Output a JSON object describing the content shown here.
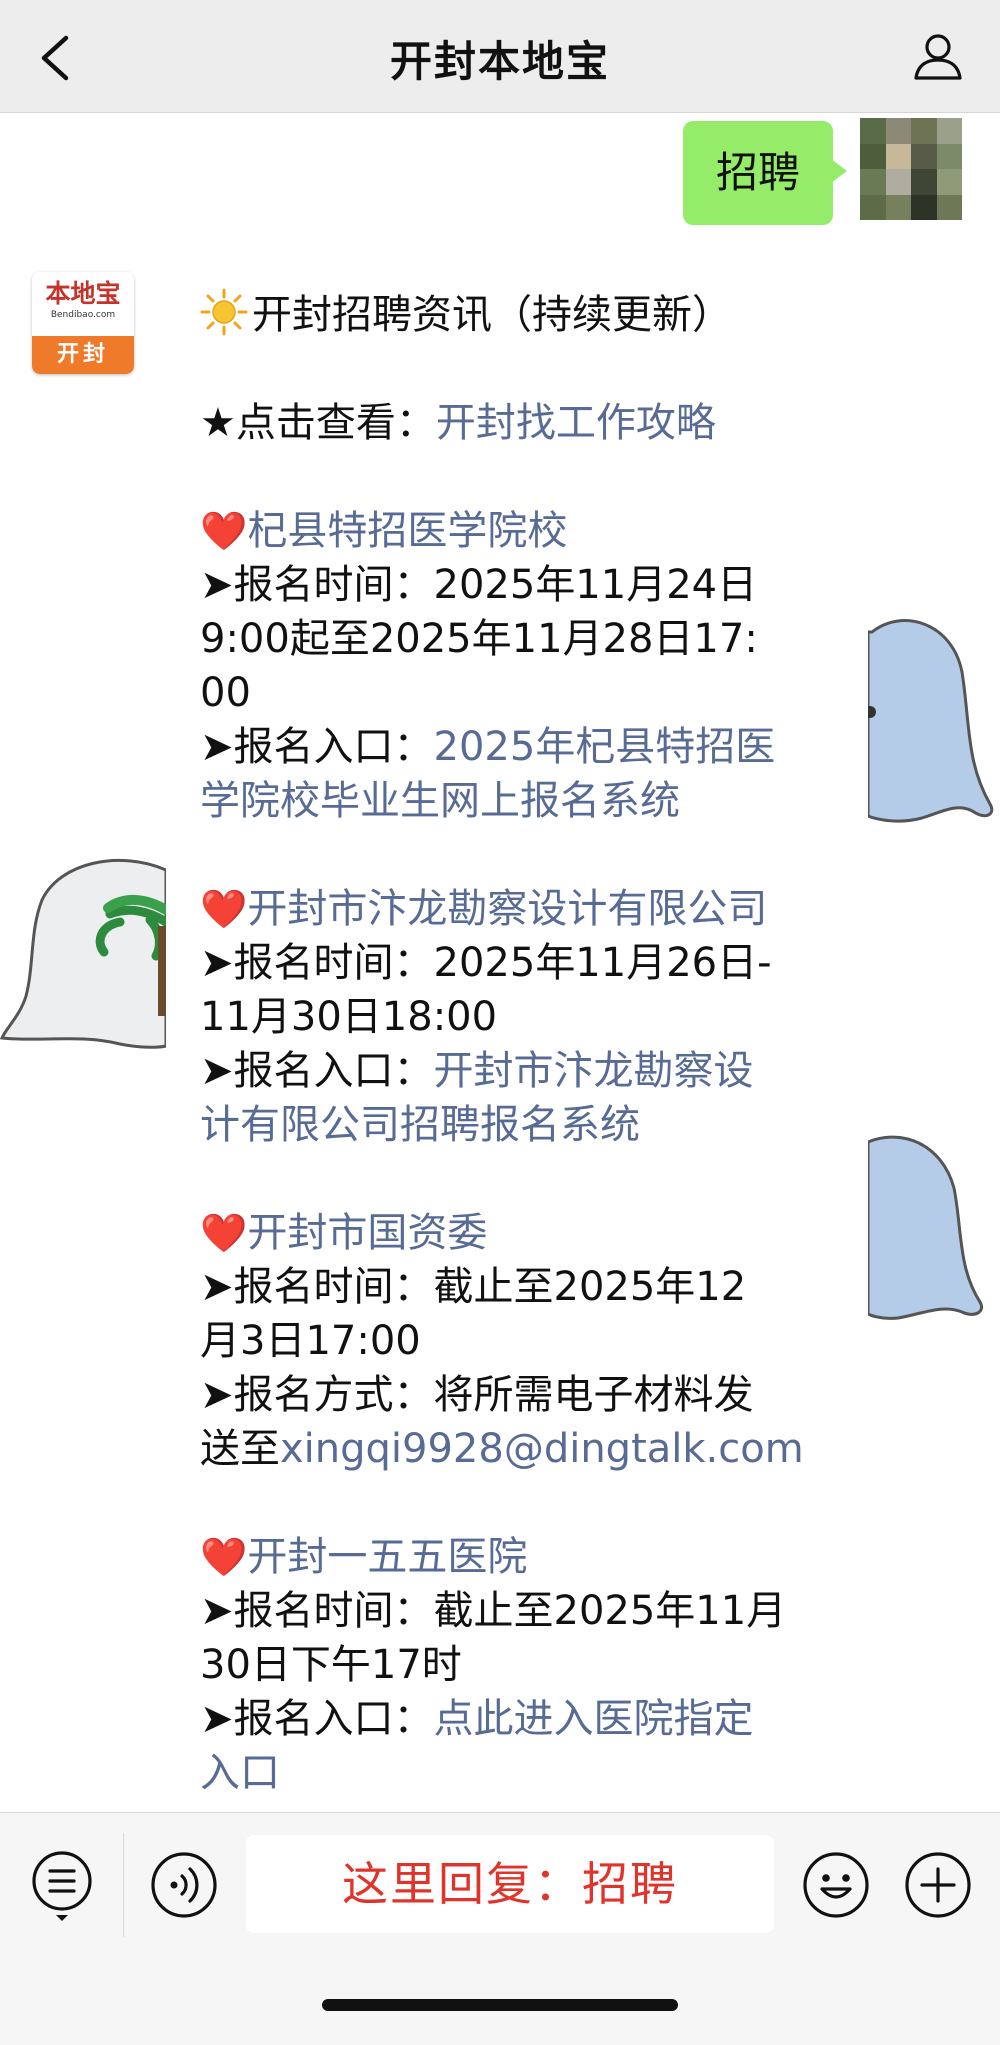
{
  "nav": {
    "title": "开封本地宝"
  },
  "sent": {
    "text": "招聘"
  },
  "account": {
    "logo_text": "本地宝",
    "logo_sub": "Bendibao.com",
    "city": "开封"
  },
  "message": {
    "header": "开封招聘资讯（持续更新）",
    "guide_prefix": "★点击查看：",
    "guide_link": "开封找工作攻略",
    "jobs": [
      {
        "heart": "❤️",
        "title": "杞县特招医学院校",
        "lines": [
          {
            "prefix": "➤报名时间：",
            "text": "2025年11月24日",
            "link": false
          },
          {
            "prefix": "",
            "text": "9:00起至2025年11月28日17:",
            "link": false
          },
          {
            "prefix": "",
            "text": "00",
            "link": false
          },
          {
            "prefix": "➤报名入口：",
            "text": "2025年杞县特招医",
            "link": true
          },
          {
            "prefix": "",
            "text": "学院校毕业生网上报名系统",
            "link": true
          }
        ]
      },
      {
        "heart": "❤️",
        "title": "开封市汴龙勘察设计有限公司",
        "lines": [
          {
            "prefix": "➤报名时间：",
            "text": "2025年11月26日-",
            "link": false
          },
          {
            "prefix": "",
            "text": "11月30日18:00",
            "link": false
          },
          {
            "prefix": "➤报名入口：",
            "text": "开封市汴龙勘察设",
            "link": true
          },
          {
            "prefix": "",
            "text": "计有限公司招聘报名系统",
            "link": true
          }
        ]
      },
      {
        "heart": "❤️",
        "title": "开封市国资委",
        "lines": [
          {
            "prefix": "➤报名时间：",
            "text": "截止至2025年12",
            "link": false
          },
          {
            "prefix": "",
            "text": "月3日17:00",
            "link": false
          },
          {
            "prefix": "➤报名方式：",
            "text": "将所需电子材料发",
            "link": false
          },
          {
            "prefix": "送至",
            "text": "xingqi9928@dingtalk.com",
            "link": true
          }
        ]
      },
      {
        "heart": "❤️",
        "title": "开封一五五医院",
        "lines": [
          {
            "prefix": "➤报名时间：",
            "text": "截止至2025年11月",
            "link": false
          },
          {
            "prefix": "",
            "text": "30日下午17时",
            "link": false
          },
          {
            "prefix": "➤报名入口：",
            "text": "点此进入医院指定",
            "link": true
          },
          {
            "prefix": "",
            "text": "入口",
            "link": true
          }
        ]
      }
    ]
  },
  "bottom": {
    "reply_prompt": "这里回复：招聘"
  },
  "icons": {
    "back": "chevron-left-icon",
    "user": "user-profile-icon",
    "menu": "menu-list-icon",
    "voice": "voice-icon",
    "emoji": "emoji-icon",
    "plus": "plus-icon"
  },
  "colors": {
    "link": "#576b95",
    "sent_bubble": "#95ec69",
    "reply_prompt": "#e0342b"
  }
}
